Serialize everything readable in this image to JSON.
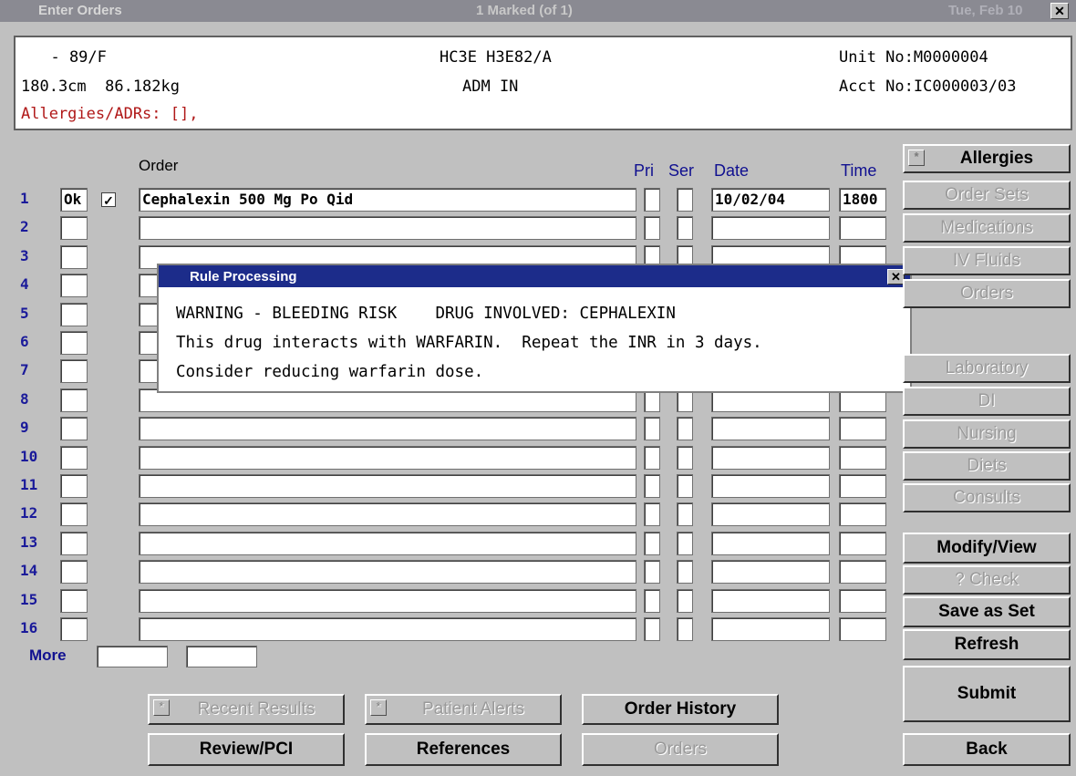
{
  "window": {
    "title": "Enter Orders",
    "marked": "1 Marked (of 1)",
    "date": "Tue, Feb 10",
    "close_glyph": "✕"
  },
  "patient": {
    "age_sex": "  - 89/F",
    "height_weight": "180.3cm  86.182kg",
    "location": "HC3E H3E82/A",
    "status": "ADM IN",
    "unit_no": "Unit No:M0000004",
    "acct_no": "Acct No:IC000003/03",
    "allergies_label": "Allergies/ADRs:",
    "allergies_value": " [],"
  },
  "columns": {
    "order": "Order",
    "pri": "Pri",
    "ser": "Ser",
    "date": "Date",
    "time": "Time"
  },
  "rows": [
    {
      "num": "1",
      "status": "Ok",
      "checked": "✓",
      "order": "Cephalexin 500 Mg Po Qid",
      "date": "10/02/04",
      "time": "1800"
    },
    {
      "num": "2"
    },
    {
      "num": "3"
    },
    {
      "num": "4"
    },
    {
      "num": "5"
    },
    {
      "num": "6"
    },
    {
      "num": "7"
    },
    {
      "num": "8"
    },
    {
      "num": "9"
    },
    {
      "num": "10"
    },
    {
      "num": "11"
    },
    {
      "num": "12"
    },
    {
      "num": "13"
    },
    {
      "num": "14"
    },
    {
      "num": "15"
    },
    {
      "num": "16"
    }
  ],
  "more_label": "More",
  "dialog": {
    "title": "Rule Processing",
    "close_glyph": "✕",
    "line1": "WARNING - BLEEDING RISK    DRUG INVOLVED: CEPHALEXIN",
    "line2": "This drug interacts with WARFARIN.  Repeat the INR in 3 days.",
    "line3": "Consider reducing warfarin dose."
  },
  "side_buttons": {
    "star": "*",
    "allergies": "Allergies",
    "order_sets": "Order Sets",
    "medications": "Medications",
    "iv_fluids": "IV Fluids",
    "orders": "Orders",
    "laboratory": "Laboratory",
    "di": "DI",
    "nursing": "Nursing",
    "diets": "Diets",
    "consults": "Consults",
    "modify_view": "Modify/View",
    "check": "? Check",
    "save_as_set": "Save as Set",
    "refresh": "Refresh",
    "submit": "Submit",
    "back": "Back"
  },
  "bottom_buttons": {
    "star": "*",
    "recent_results": "Recent Results",
    "patient_alerts": "Patient Alerts",
    "order_history": "Order History",
    "review_pci": "Review/PCI",
    "references": "References",
    "orders": "Orders"
  }
}
